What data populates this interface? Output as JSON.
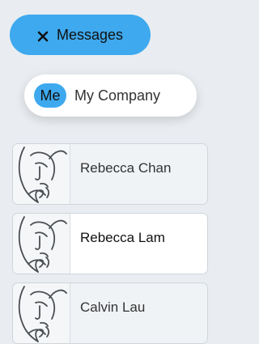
{
  "header": {
    "messages_label": "Messages",
    "close_icon": "close-icon"
  },
  "company": {
    "me_label": "Me",
    "company_label": "My Company"
  },
  "contacts": [
    {
      "name": "Rebecca Chan",
      "state": "selected"
    },
    {
      "name": "Rebecca Lam",
      "state": "active"
    },
    {
      "name": "Calvin Lau",
      "state": "selected"
    }
  ],
  "colors": {
    "accent": "#3ea9ee",
    "background": "#e9edf1",
    "card": "#ffffff"
  }
}
